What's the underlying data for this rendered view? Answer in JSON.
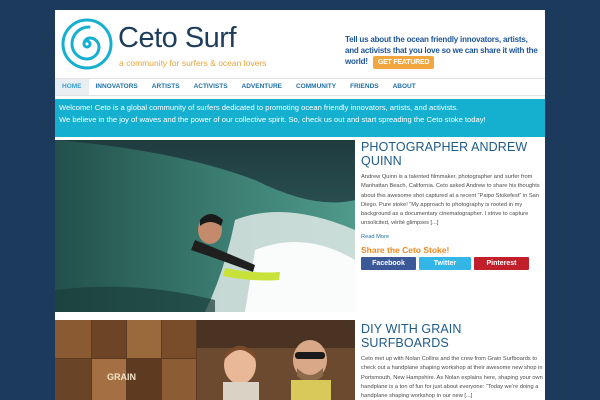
{
  "header": {
    "title": "Ceto Surf",
    "tagline": "a community for surfers & ocean lovers",
    "promo_text": "Tell us about the ocean friendly innovators, artists, and activists that you love so we can share it with the world!",
    "promo_button": "GET FEATURED"
  },
  "nav": {
    "items": [
      "HOME",
      "INNOVATORS",
      "ARTISTS",
      "ACTIVISTS",
      "ADVENTURE",
      "COMMUNITY",
      "FRIENDS",
      "ABOUT"
    ]
  },
  "welcome": {
    "line1": "Welcome! Ceto is a global community of surfers dedicated to promoting ocean friendly innovators, artists, and activists.",
    "line2": "We believe in the joy of waves and the power of our collective spirit. So, check us out and start spreading the Ceto stoke today!"
  },
  "posts": [
    {
      "title": "PHOTOGRAPHER ANDREW QUINN",
      "excerpt": "Andrew Quinn is a talented filmmaker, photographer and surfer from Manhattan Beach, California. Ceto asked Andrew to share his thoughts about this awesome shot captured at a recent “Paipo Stokefest” in San Diego. Pure stoke! “My approach to photography is rooted in my background as a documentary cinematographer. I strive to capture unsolicited, vérité glimpses [...]",
      "read_more": "Read More",
      "share_title": "Share the Ceto Stoke!",
      "share_facebook": "Facebook",
      "share_twitter": "Twitter",
      "share_pinterest": "Pinterest"
    },
    {
      "title": "DIY WITH GRAIN SURFBOARDS",
      "excerpt": "Ceto met up with Nolan Collins and the crew from Grain Surfboards to check out a handplane shaping workshop at their awesome new shop in Portsmouth, New Hampshire. As Nolan explains here, shaping your own handplane is a ton of fun for just about everyone: “Today we’re doing a handplane shaping workshop in our new [...]",
      "grain_sign": "GRAIN"
    }
  ],
  "colors": {
    "background": "#1b3a5c",
    "accent": "#15b0d0",
    "nav_link": "#1e6fa8",
    "promo_button": "#f2a640",
    "share_title": "#f08a24"
  }
}
